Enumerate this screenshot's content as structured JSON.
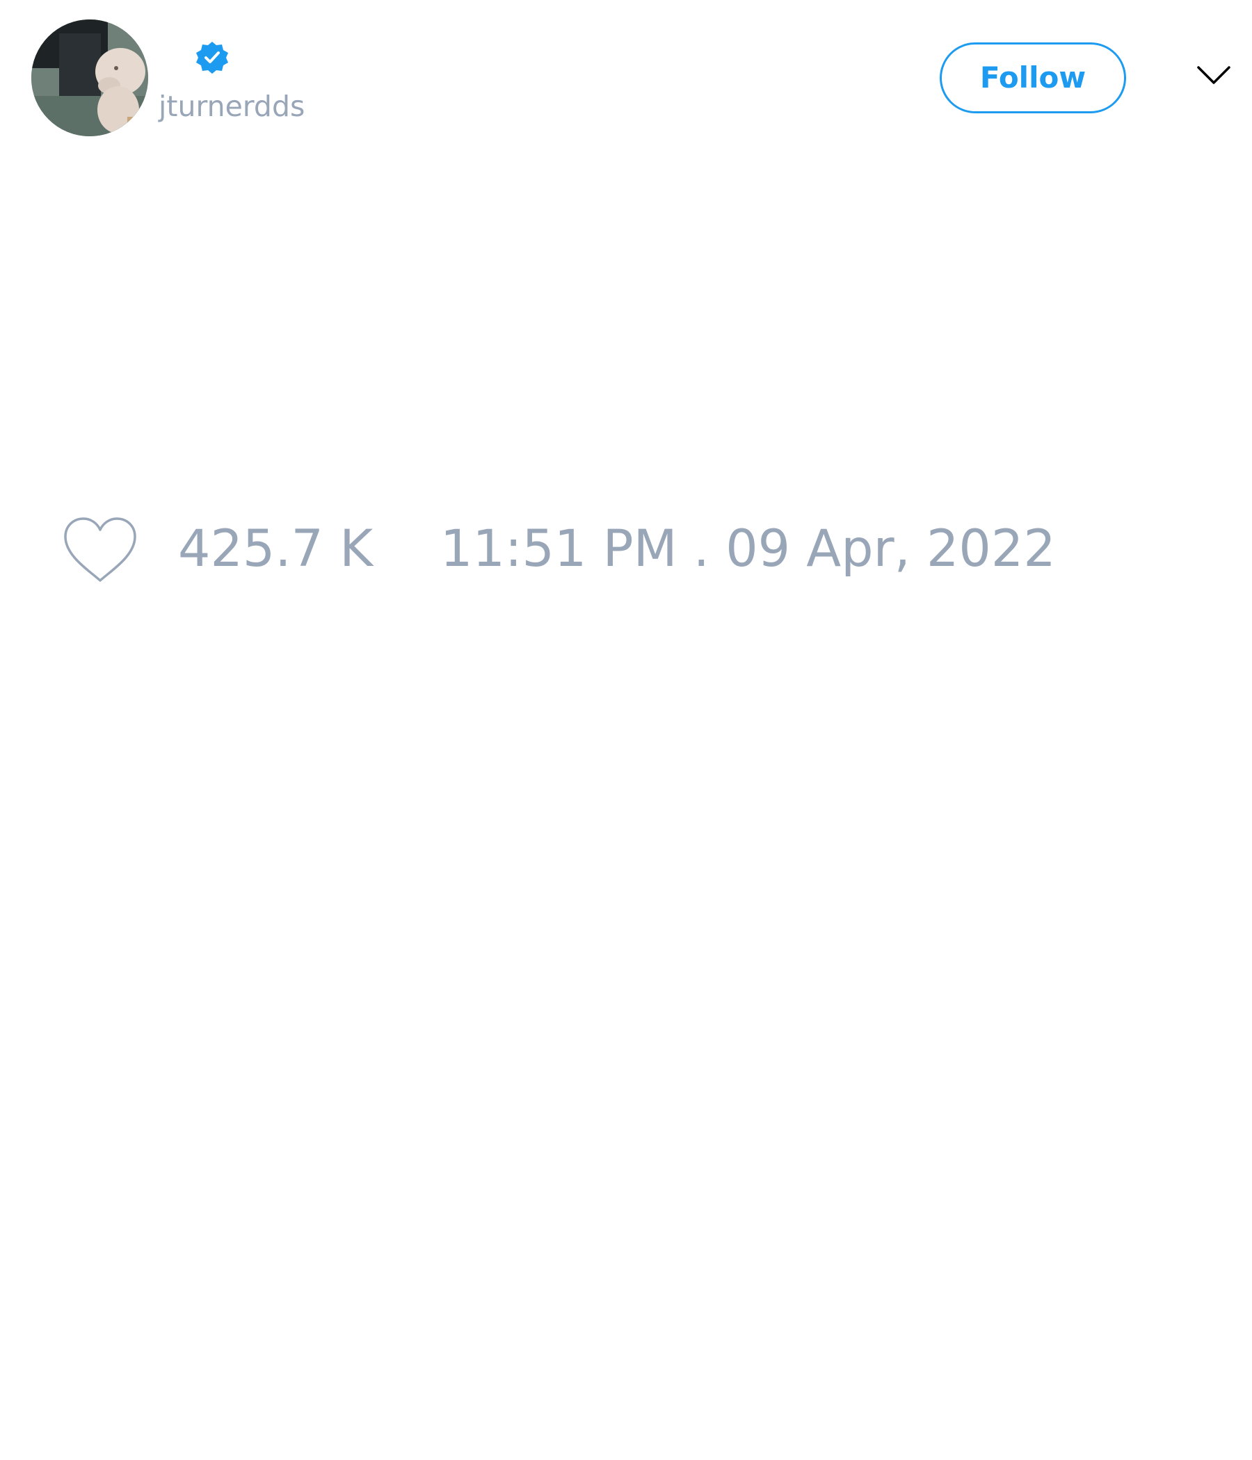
{
  "author": {
    "handle": "jturnerdds",
    "verified": true,
    "avatar": "profile-photo"
  },
  "actions": {
    "follow_label": "Follow",
    "menu_icon": "chevron-down-icon"
  },
  "tweet": {
    "like_icon": "heart-outline-icon",
    "like_count": "425.7 K",
    "timestamp": "11:51 PM . 09 Apr, 2022"
  },
  "colors": {
    "accent": "#1d9bf0",
    "muted_text": "#98a6b8",
    "background": "#ffffff"
  }
}
